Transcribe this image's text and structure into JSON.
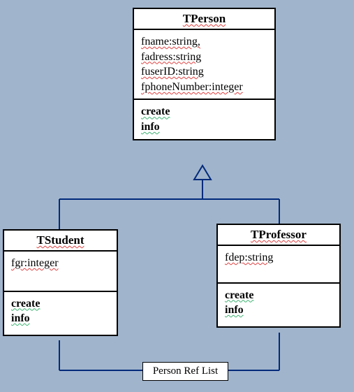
{
  "classes": {
    "person": {
      "name": "TPerson",
      "attrs": [
        "fname:string,",
        "fadress:string",
        "fuserID:string",
        "fphoneNumber:integer"
      ],
      "ops": [
        "create",
        "info"
      ]
    },
    "student": {
      "name": "TStudent",
      "attrs": [
        "fgr:integer"
      ],
      "ops": [
        "create",
        "info"
      ]
    },
    "professor": {
      "name": "TProfessor",
      "attrs": [
        "fdep:string"
      ],
      "ops": [
        "create",
        "info"
      ]
    }
  },
  "ref_label": "Person Ref List"
}
